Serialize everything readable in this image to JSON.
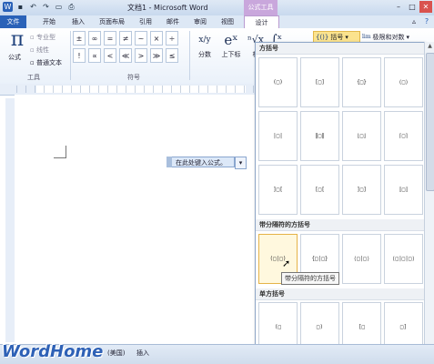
{
  "window": {
    "title": "文档1 - Microsoft Word",
    "context_tab": "公式工具"
  },
  "quick_access": {
    "icons": [
      "save-icon",
      "undo-icon",
      "redo-icon",
      "open-icon",
      "print-icon"
    ]
  },
  "tabs": [
    {
      "label": "文件"
    },
    {
      "label": "开始"
    },
    {
      "label": "插入"
    },
    {
      "label": "页面布局"
    },
    {
      "label": "引用"
    },
    {
      "label": "邮件"
    },
    {
      "label": "审阅"
    },
    {
      "label": "视图"
    },
    {
      "label": "设计"
    }
  ],
  "ribbon": {
    "tools_group": {
      "label": "工具",
      "formula_glyph": "π",
      "formula_label": "公式",
      "professional": "专业型",
      "linear": "线性",
      "normal_text": "普通文本"
    },
    "symbols_group": {
      "label": "符号",
      "symbols": [
        "±",
        "∞",
        "=",
        "≠",
        "~",
        "×",
        "÷",
        "!",
        "∝",
        "<",
        "≪",
        ">",
        "≫",
        "≤"
      ]
    },
    "structures": {
      "fraction": {
        "glyph": "x/y",
        "label": "分数"
      },
      "script": {
        "glyph": "eˣ",
        "label": "上下标"
      },
      "radical": {
        "glyph": "ⁿ√x",
        "label": "根"
      },
      "integral": {
        "glyph": "∫ˣ",
        "label": ""
      },
      "bracket": {
        "glyph": "{()}",
        "label": "括号"
      },
      "limits": {
        "glyph": "lim",
        "label": "极限和对数"
      }
    }
  },
  "document": {
    "equation_placeholder": "在此处键入公式。"
  },
  "panel": {
    "sections": [
      {
        "title": "方括号",
        "items": [
          "(□)",
          "[□]",
          "{□}",
          "⟨□⟩",
          "|□|",
          "‖□‖",
          "⌊□⌋",
          "⌈□⌉",
          "|□|",
          "‖□‖",
          "]□[",
          "[□[",
          "]□]",
          "⟦□⟧",
          "]□["
        ]
      },
      {
        "title": "带分隔符的方括号",
        "items": [
          "(□|□)",
          "{□|□}",
          "⟨□|□⟩",
          "⟨□|□|□⟩"
        ]
      },
      {
        "title": "单方括号",
        "items": [
          "(□",
          "□)",
          "[□",
          "□]"
        ]
      }
    ],
    "tooltip": "带分隔符的方括号"
  },
  "status": {
    "language": "(美国)",
    "insert_mode": "插入"
  },
  "watermark": "WordHome"
}
